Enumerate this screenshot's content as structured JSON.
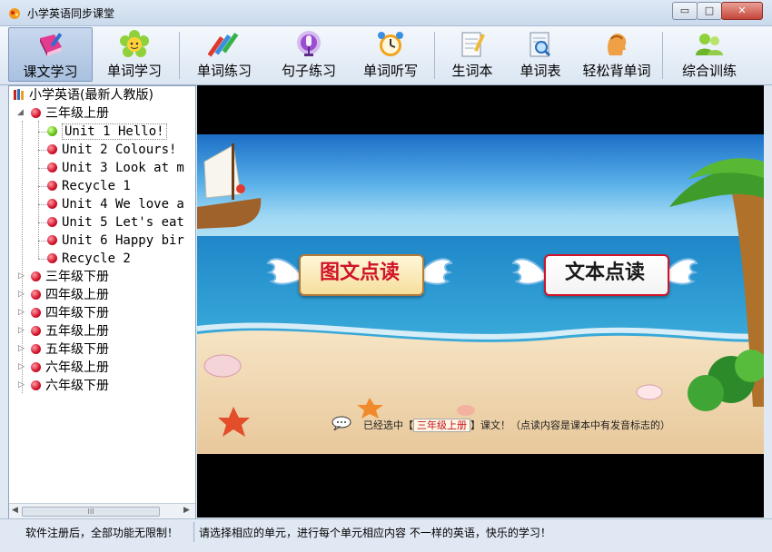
{
  "window": {
    "title": "小学英语同步课堂",
    "minimize": "▭",
    "maximize": "□",
    "close": "✕"
  },
  "toolbar": {
    "items": [
      {
        "label": "课文学习",
        "icon": "book-pen-icon",
        "active": true
      },
      {
        "label": "单词学习",
        "icon": "flower-icon"
      },
      {
        "label": "单词练习",
        "icon": "pencils-icon"
      },
      {
        "label": "句子练习",
        "icon": "microphone-icon"
      },
      {
        "label": "单词听写",
        "icon": "alarm-clock-icon"
      },
      {
        "label": "生词本",
        "icon": "notepad-pencil-icon"
      },
      {
        "label": "单词表",
        "icon": "magnifier-list-icon"
      },
      {
        "label": "轻松背单词",
        "icon": "head-profile-icon"
      },
      {
        "label": "综合训练",
        "icon": "people-icon"
      }
    ]
  },
  "tree": {
    "root": "小学英语(最新人教版)",
    "grades": [
      {
        "label": "三年级上册",
        "expanded": true,
        "units": [
          {
            "label": "Unit 1 Hello!",
            "selected": true
          },
          {
            "label": "Unit 2 Colours!"
          },
          {
            "label": "Unit 3 Look at m"
          },
          {
            "label": "Recycle 1"
          },
          {
            "label": "Unit 4 We love a"
          },
          {
            "label": "Unit 5 Let's eat"
          },
          {
            "label": "Unit 6 Happy bir"
          },
          {
            "label": "Recycle 2"
          }
        ]
      },
      {
        "label": "三年级下册"
      },
      {
        "label": "四年级上册"
      },
      {
        "label": "四年级下册"
      },
      {
        "label": "五年级上册"
      },
      {
        "label": "五年级下册"
      },
      {
        "label": "六年级上册"
      },
      {
        "label": "六年级下册"
      }
    ],
    "scrollbar_grip": "III"
  },
  "scene": {
    "buttons": {
      "picture_read": "图文点读",
      "text_read": "文本点读"
    },
    "hint": {
      "prefix": "已经选中【",
      "selected": "三年级上册",
      "suffix": "】课文！（点读内容是课本中有发音标志的）"
    }
  },
  "status": {
    "left": "软件注册后，全部功能无限制！",
    "right": "请选择相应的单元，进行每个单元相应内容 不一样的英语，快乐的学习！"
  },
  "colors": {
    "picture_read_text": "#d0142a",
    "text_read_text": "#1a1a1a",
    "accent_red": "#c4141b"
  }
}
